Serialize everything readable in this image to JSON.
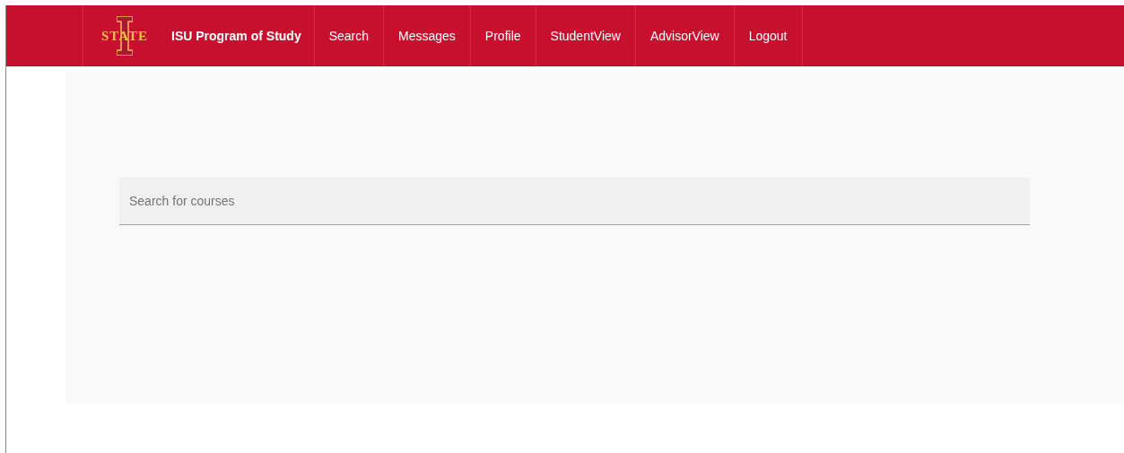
{
  "navbar": {
    "logo_text": "STATE",
    "brand": "ISU Program of Study",
    "items": [
      {
        "label": "Search"
      },
      {
        "label": "Messages"
      },
      {
        "label": "Profile"
      },
      {
        "label": "StudentView"
      },
      {
        "label": "AdvisorView"
      },
      {
        "label": "Logout"
      }
    ]
  },
  "search": {
    "placeholder": "Search for courses"
  }
}
